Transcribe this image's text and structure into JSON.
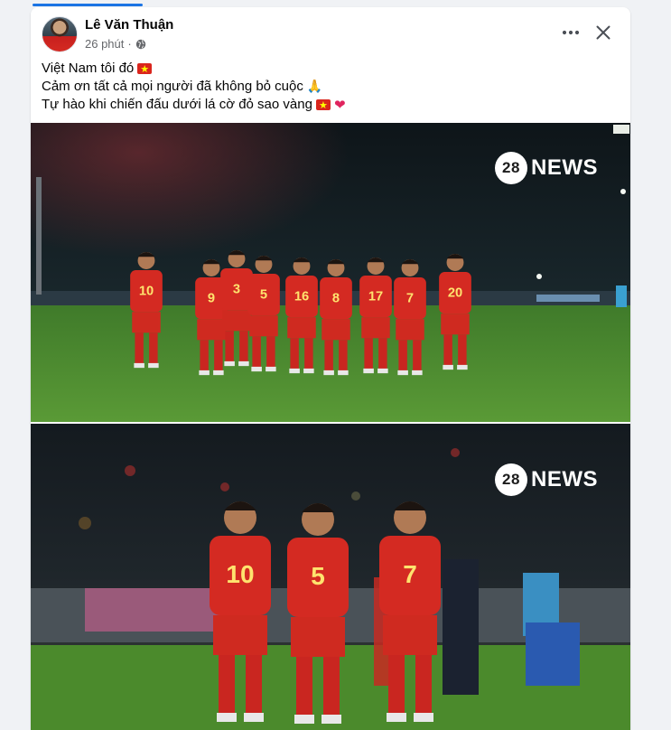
{
  "post": {
    "author": "Lê Văn Thuận",
    "time": "26 phút",
    "caption_lines": [
      "Việt Nam tôi đó",
      "Cảm ơn tất cả mọi người đã không bỏ cuộc",
      "Tự hào khi chiến đấu dưới lá cờ đỏ sao vàng"
    ],
    "privacy_icon": "globe-icon"
  },
  "actions": {
    "more_icon": "•••",
    "close_icon": "✕"
  },
  "photos": [
    {
      "watermark_number": "28",
      "watermark_text": "NEWS",
      "jersey_numbers": [
        "10",
        "9",
        "3",
        "5",
        "16",
        "8",
        "17",
        "7",
        "20"
      ]
    },
    {
      "watermark_number": "28",
      "watermark_text": "NEWS",
      "jersey_numbers": [
        "10",
        "5",
        "7"
      ]
    }
  ],
  "colors": {
    "accent": "#1b74e4",
    "jersey_red": "#d42a22",
    "pitch_green": "#4f8a2e",
    "flag_red": "#da251d",
    "flag_star": "#ffff00"
  }
}
